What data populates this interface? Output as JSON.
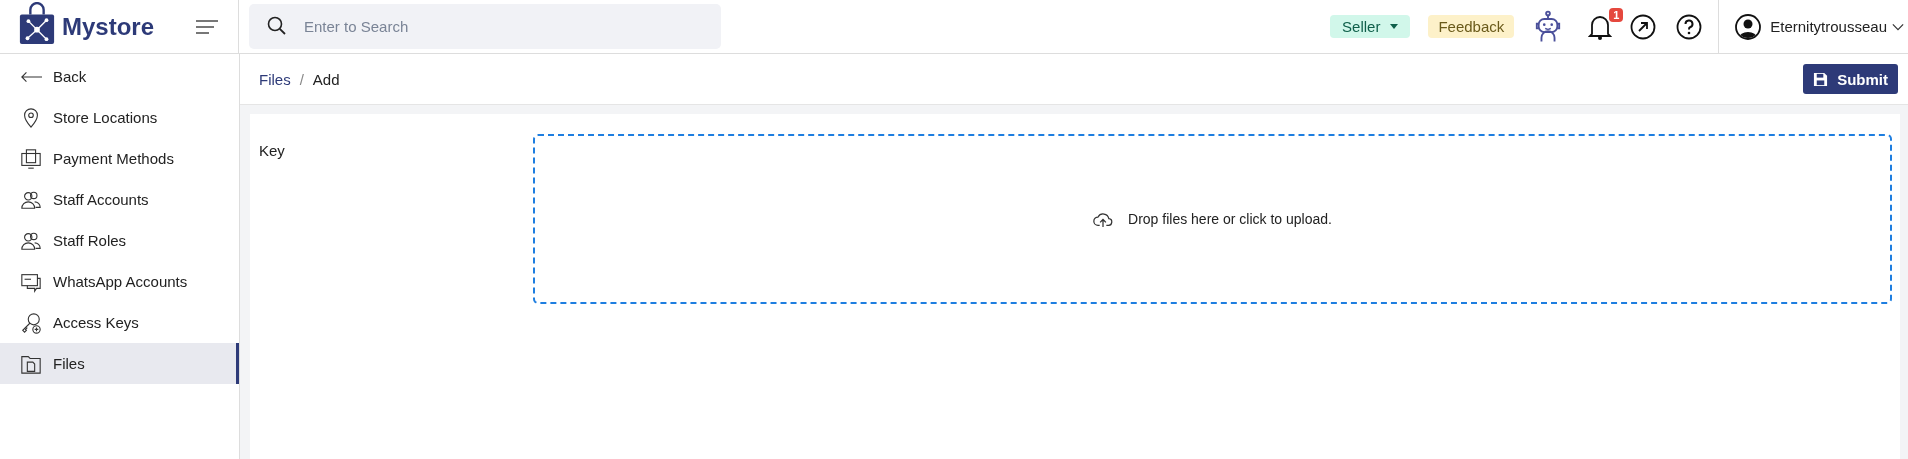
{
  "brand": {
    "name": "Mystore"
  },
  "search": {
    "placeholder": "Enter to Search"
  },
  "header": {
    "role": "Seller",
    "feedback": "Feedback",
    "notifications": "1",
    "user": "Eternitytrousseau"
  },
  "sidebar": {
    "items": [
      {
        "label": "Back",
        "selected": false
      },
      {
        "label": "Store Locations",
        "selected": false
      },
      {
        "label": "Payment Methods",
        "selected": false
      },
      {
        "label": "Staff Accounts",
        "selected": false
      },
      {
        "label": "Staff Roles",
        "selected": false
      },
      {
        "label": "WhatsApp Accounts",
        "selected": false
      },
      {
        "label": "Access Keys",
        "selected": false
      },
      {
        "label": "Files",
        "selected": true
      }
    ]
  },
  "breadcrumb": [
    "Files",
    "Add"
  ],
  "breadcrumb_separator": "/",
  "submit": "Submit",
  "form": {
    "label": "Key",
    "dropzone": "Drop files here or click to upload."
  }
}
